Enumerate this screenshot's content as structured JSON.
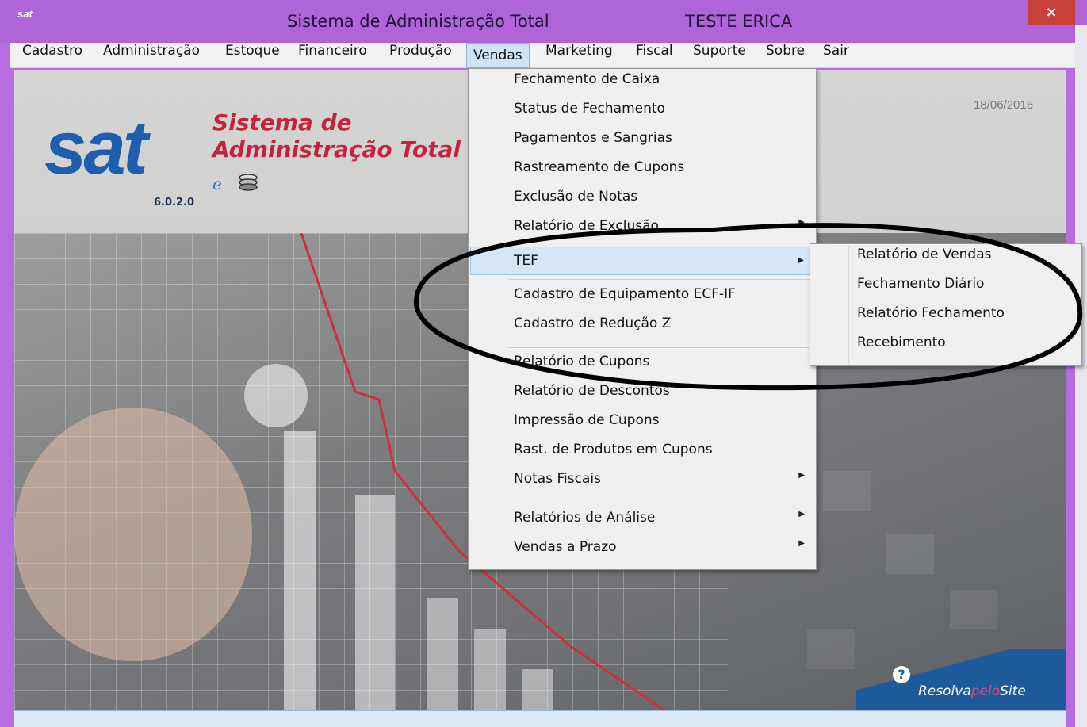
{
  "window": {
    "app_icon": "sat",
    "title": "Sistema de Administração Total",
    "user": "TESTE ERICA",
    "close": "×"
  },
  "menubar": {
    "items": [
      "Cadastro",
      "Administração",
      "Estoque",
      "Financeiro",
      "Produção",
      "Vendas",
      "Marketing",
      "Fiscal",
      "Suporte",
      "Sobre",
      "Sair"
    ],
    "active": "Vendas"
  },
  "background": {
    "date": "18/06/2015",
    "logo_text": "sat",
    "logo_title_line1": "Sistema de",
    "logo_title_line2": "Administração Total",
    "version": "6.0.2.0",
    "resolva_prefix": "Resolva",
    "resolva_mid": "pelo",
    "resolva_suffix": "Site",
    "resolva_icon": "?"
  },
  "vendas_menu": {
    "items": [
      {
        "label": "Fechamento de Caixa",
        "submenu": false
      },
      {
        "label": "Status de Fechamento",
        "submenu": false
      },
      {
        "label": "Pagamentos e Sangrias",
        "submenu": false
      },
      {
        "label": "Rastreamento de Cupons",
        "submenu": false
      },
      {
        "label": "Exclusão de Notas",
        "submenu": false
      },
      {
        "label": "Relatório de Exclusão",
        "submenu": true
      },
      {
        "label": "TEF",
        "submenu": true,
        "highlighted": true
      },
      {
        "label": "Cadastro de Equipamento ECF-IF",
        "submenu": false
      },
      {
        "label": "Cadastro de Redução Z",
        "submenu": false
      },
      {
        "label": "Relatório de Cupons",
        "submenu": false
      },
      {
        "label": "Relatório de Descontos",
        "submenu": false
      },
      {
        "label": "Impressão de Cupons",
        "submenu": false
      },
      {
        "label": "Rast. de Produtos em Cupons",
        "submenu": false
      },
      {
        "label": "Notas Fiscais",
        "submenu": true
      },
      {
        "label": "Relatórios de Análise",
        "submenu": true
      },
      {
        "label": "Vendas a Prazo",
        "submenu": true
      }
    ],
    "arrow": "▶"
  },
  "tef_menu": {
    "items": [
      "Relatório de Vendas",
      "Fechamento Diário",
      "Relatório Fechamento",
      "Recebimento"
    ]
  },
  "colors": {
    "titlebar": "#b064d9",
    "close": "#c7403a",
    "logo_blue": "#1d5fae",
    "logo_red": "#c5233a",
    "menu_highlight": "#d4e6f8"
  }
}
